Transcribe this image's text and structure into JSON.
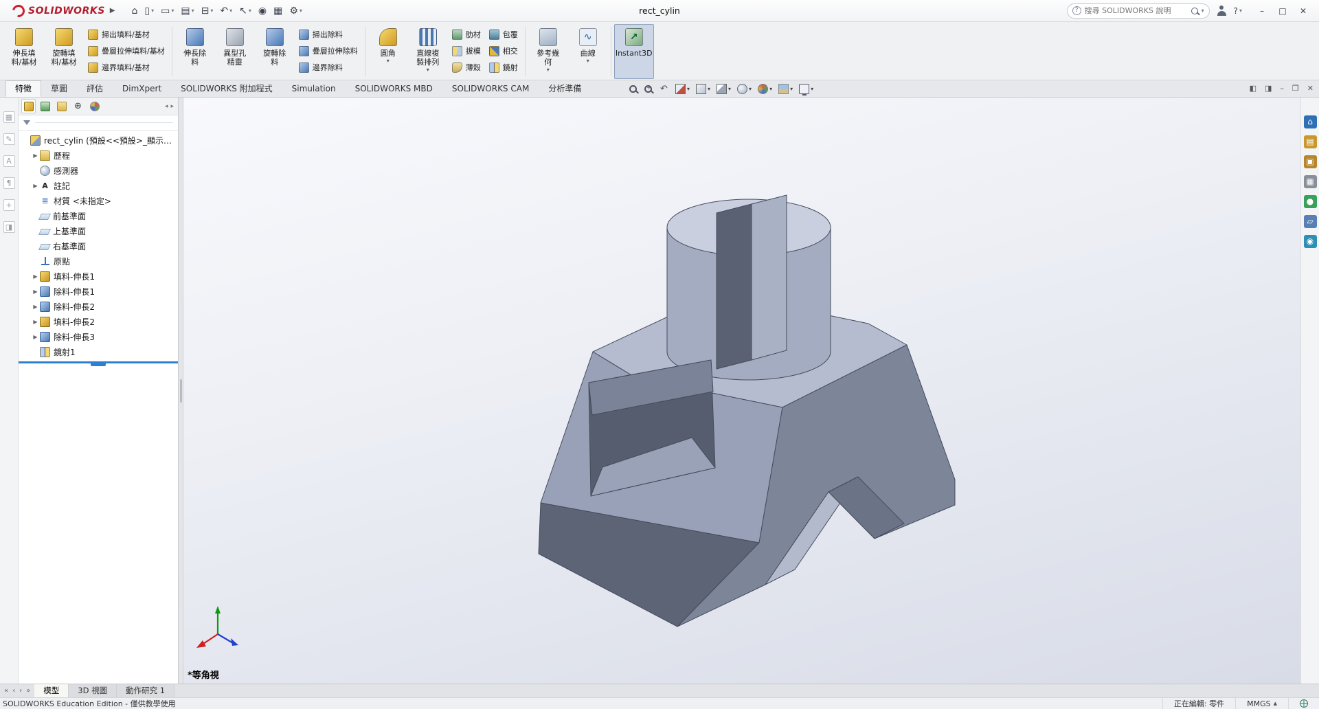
{
  "colors": {
    "accent_blue": "#2d7fd3",
    "boss_gold": "#cf9b22",
    "cut_blue": "#4a78b4",
    "logo_red": "#cf1f2f",
    "rollback_blue": "#2d7fd3"
  },
  "titlebar": {
    "brand": "SOLIDWORKS",
    "doc_title": "rect_cylin",
    "help_glyph": "?",
    "search": {
      "placeholder": "搜尋 SOLIDWORKS 說明"
    },
    "quick_tools": [
      {
        "name": "home",
        "glyph": "⌂",
        "arrow": false
      },
      {
        "name": "new-document",
        "glyph": "▯",
        "arrow": true
      },
      {
        "name": "open-document",
        "glyph": "▭",
        "arrow": true
      },
      {
        "name": "save",
        "glyph": "▤",
        "arrow": true
      },
      {
        "name": "print",
        "glyph": "⊟",
        "arrow": true
      },
      {
        "name": "undo",
        "glyph": "↶",
        "arrow": true
      },
      {
        "name": "select",
        "glyph": "↖",
        "arrow": true
      },
      {
        "name": "touch-mode",
        "glyph": "◉",
        "arrow": false
      },
      {
        "name": "rebuild",
        "glyph": "▦",
        "arrow": false
      },
      {
        "name": "options",
        "glyph": "⚙",
        "arrow": true
      }
    ],
    "window_controls": [
      {
        "name": "minimize",
        "glyph": "–"
      },
      {
        "name": "maximize",
        "glyph": "□"
      },
      {
        "name": "close",
        "glyph": "✕"
      }
    ]
  },
  "ribbon": {
    "tabs": [
      {
        "name": "features",
        "label": "特徵",
        "active": true
      },
      {
        "name": "sketch",
        "label": "草圖",
        "active": false
      },
      {
        "name": "evaluate",
        "label": "評估",
        "active": false
      },
      {
        "name": "dimxpert",
        "label": "DimXpert",
        "active": false
      },
      {
        "name": "solidworks-add-ins",
        "label": "SOLIDWORKS 附加程式",
        "active": false
      },
      {
        "name": "simulation",
        "label": "Simulation",
        "active": false
      },
      {
        "name": "solidworks-mbd",
        "label": "SOLIDWORKS MBD",
        "active": false
      },
      {
        "name": "solidworks-cam",
        "label": "SOLIDWORKS CAM",
        "active": false
      },
      {
        "name": "analysis-preparation",
        "label": "分析準備",
        "active": false
      }
    ],
    "columns": [
      {
        "type": "large",
        "name": "extruded-boss-base",
        "icon": "boss",
        "lines": [
          "伸長填",
          "料/基材"
        ],
        "arrow": false
      },
      {
        "type": "large",
        "name": "revolved-boss-base",
        "icon": "boss",
        "lines": [
          "旋轉填",
          "料/基材"
        ],
        "arrow": false
      },
      {
        "type": "stack",
        "items": [
          {
            "name": "swept-boss-base",
            "icon": "boss",
            "label": "掃出填料/基材"
          },
          {
            "name": "lofted-boss-base",
            "icon": "boss",
            "label": "疊層拉伸填料/基材"
          },
          {
            "name": "boundary-boss-base",
            "icon": "boss",
            "label": "邊界填料/基材"
          }
        ]
      },
      {
        "type": "sep"
      },
      {
        "type": "large",
        "name": "extruded-cut",
        "icon": "cut",
        "lines": [
          "伸長除",
          "料"
        ],
        "arrow": false
      },
      {
        "type": "large",
        "name": "hole-wizard",
        "icon": "hole",
        "lines": [
          "異型孔",
          "精靈"
        ],
        "arrow": false
      },
      {
        "type": "large",
        "name": "revolved-cut",
        "icon": "cut",
        "lines": [
          "旋轉除",
          "料"
        ],
        "arrow": false
      },
      {
        "type": "stack",
        "items": [
          {
            "name": "swept-cut",
            "icon": "cut",
            "label": "掃出除料"
          },
          {
            "name": "lofted-cut",
            "icon": "cut",
            "label": "疊層拉伸除料"
          },
          {
            "name": "boundary-cut",
            "icon": "cut",
            "label": "邊界除料"
          }
        ]
      },
      {
        "type": "sep"
      },
      {
        "type": "large",
        "name": "fillet",
        "icon": "fillet",
        "lines": [
          "圓角"
        ],
        "arrow": true
      },
      {
        "type": "large",
        "name": "linear-pattern",
        "icon": "pattern",
        "lines": [
          "直線複",
          "製排列"
        ],
        "arrow": true
      },
      {
        "type": "stack",
        "items": [
          {
            "name": "rib",
            "icon": "rib",
            "label": "肋材"
          },
          {
            "name": "draft",
            "icon": "draft",
            "label": "拔模"
          },
          {
            "name": "shell",
            "icon": "shell",
            "label": "薄殼"
          }
        ]
      },
      {
        "type": "stack",
        "items": [
          {
            "name": "wrap",
            "icon": "wrap",
            "label": "包覆"
          },
          {
            "name": "intersect",
            "icon": "intersect",
            "label": "相交"
          },
          {
            "name": "mirror",
            "icon": "mirror",
            "label": "鏡射"
          }
        ]
      },
      {
        "type": "sep"
      },
      {
        "type": "large",
        "name": "reference-geometry",
        "icon": "refgeo",
        "lines": [
          "參考幾",
          "何"
        ],
        "arrow": true
      },
      {
        "type": "large",
        "name": "curves",
        "icon": "curves",
        "lines": [
          "曲線"
        ],
        "arrow": true
      },
      {
        "type": "sep"
      },
      {
        "type": "large",
        "name": "instant3d",
        "icon": "instant3d",
        "lines": [
          "Instant3D"
        ],
        "arrow": false,
        "active": true
      }
    ]
  },
  "headsup": {
    "items": [
      {
        "name": "zoom-to-fit",
        "arrow": false
      },
      {
        "name": "zoom-to-area",
        "arrow": false
      },
      {
        "name": "previous-view",
        "arrow": false
      },
      {
        "name": "section-view",
        "arrow": true
      },
      {
        "name": "view-orientation",
        "arrow": true
      },
      {
        "name": "display-style",
        "arrow": true
      },
      {
        "name": "hide-show-items",
        "arrow": true
      },
      {
        "name": "edit-appearance",
        "arrow": true
      },
      {
        "name": "apply-scene",
        "arrow": true
      },
      {
        "name": "view-settings",
        "arrow": true
      }
    ]
  },
  "document_controls": [
    {
      "name": "pane-left",
      "glyph": "◧"
    },
    {
      "name": "pane-right",
      "glyph": "◨"
    },
    {
      "name": "minimize-document",
      "glyph": "–"
    },
    {
      "name": "restore-document",
      "glyph": "❐"
    },
    {
      "name": "close-document",
      "glyph": "✕"
    }
  ],
  "left_toolbar": {
    "icons": [
      {
        "glyph": "▦"
      },
      {
        "glyph": "✎"
      },
      {
        "glyph": "A"
      },
      {
        "glyph": "¶"
      },
      {
        "glyph": "+"
      },
      {
        "glyph": "◨"
      }
    ]
  },
  "panel": {
    "tabs": [
      {
        "name": "feature-manager-design-tree",
        "active": true
      },
      {
        "name": "property-manager",
        "active": false
      },
      {
        "name": "configuration-manager",
        "active": false
      },
      {
        "name": "dimxpert-manager",
        "active": false
      },
      {
        "name": "display-manager",
        "active": false
      }
    ],
    "scroll": [
      {
        "glyph": "◂"
      },
      {
        "glyph": "▸"
      }
    ]
  },
  "feature_tree": {
    "rollback": true,
    "items": [
      {
        "name": "part-root",
        "label": "rect_cylin (預設<<預設>_顯示狀...",
        "icon": "part",
        "arrow": false,
        "level": 0
      },
      {
        "name": "history",
        "label": "歷程",
        "icon": "history-folder",
        "arrow": true,
        "level": 1
      },
      {
        "name": "sensors",
        "label": "感測器",
        "icon": "sensors",
        "arrow": false,
        "level": 1
      },
      {
        "name": "annotations",
        "label": "註記",
        "icon": "annotations",
        "arrow": true,
        "level": 1
      },
      {
        "name": "material",
        "label": "材質 <未指定>",
        "icon": "material",
        "arrow": false,
        "level": 1
      },
      {
        "name": "front-plane",
        "label": "前基準面",
        "icon": "plane",
        "arrow": false,
        "level": 1
      },
      {
        "name": "top-plane",
        "label": "上基準面",
        "icon": "plane",
        "arrow": false,
        "level": 1
      },
      {
        "name": "right-plane",
        "label": "右基準面",
        "icon": "plane",
        "arrow": false,
        "level": 1
      },
      {
        "name": "origin",
        "label": "原點",
        "icon": "origin",
        "arrow": false,
        "level": 1
      },
      {
        "name": "boss-extrude1",
        "label": "填料-伸長1",
        "icon": "boss-extrude",
        "arrow": true,
        "level": 1
      },
      {
        "name": "cut-extrude1",
        "label": "除料-伸長1",
        "icon": "cut-extrude",
        "arrow": true,
        "level": 1
      },
      {
        "name": "cut-extrude2",
        "label": "除料-伸長2",
        "icon": "cut-extrude",
        "arrow": true,
        "level": 1
      },
      {
        "name": "boss-extrude2",
        "label": "填料-伸長2",
        "icon": "boss-extrude",
        "arrow": true,
        "level": 1
      },
      {
        "name": "cut-extrude3",
        "label": "除料-伸長3",
        "icon": "cut-extrude",
        "arrow": true,
        "level": 1
      },
      {
        "name": "mirror1",
        "label": "鏡射1",
        "icon": "mirror",
        "arrow": false,
        "level": 1
      }
    ]
  },
  "viewport": {
    "view_label": "*等角視"
  },
  "task_pane": [
    {
      "name": "solidworks-resources",
      "glyph": "⌂",
      "color": "#2e6fb5"
    },
    {
      "name": "design-library",
      "glyph": "▤",
      "color": "#c9972c"
    },
    {
      "name": "file-explorer",
      "glyph": "▣",
      "color": "#b5862e"
    },
    {
      "name": "view-palette",
      "glyph": "▦",
      "color": "#888f99"
    },
    {
      "name": "appearances-scenes",
      "glyph": "●",
      "color": "#3aa05a"
    },
    {
      "name": "custom-properties",
      "glyph": "▱",
      "color": "#5a7fb5"
    },
    {
      "name": "solidworks-forum",
      "glyph": "◉",
      "color": "#2e8fb5"
    }
  ],
  "doc_tabs": {
    "nav": [
      {
        "glyph": "«"
      },
      {
        "glyph": "‹"
      },
      {
        "glyph": "›"
      },
      {
        "glyph": "»"
      }
    ],
    "tabs": [
      {
        "name": "model",
        "label": "模型",
        "active": true
      },
      {
        "name": "3d-views",
        "label": "3D 視圖",
        "active": false
      },
      {
        "name": "motion-study-1",
        "label": "動作研究 1",
        "active": false
      }
    ]
  },
  "status_bar": {
    "edition": "SOLIDWORKS Education Edition - 僅供教學使用",
    "editing_label": "正在編輯: 零件",
    "units": "MMGS"
  }
}
